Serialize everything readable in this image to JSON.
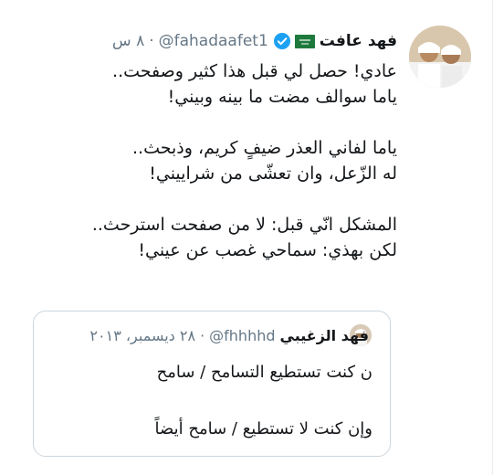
{
  "tweet": {
    "display_name": "فهد عافت",
    "handle": "@fahadaafet1",
    "separator": "·",
    "time": "٨ س",
    "body": "عادي! حصل لي قبل هذا كثير وصفحت..\nياما سوالف مضت ما بينه وبيني!\n\nياما لفاني العذر ضيفٍ كريم، وذبحث..\nله الزّعل، وان تعشّى من شراييني!\n\nالمشكل انّي قبل: لا من صفحت استرحث..\nلكن بهذي: سماحي غصب عن عيني!"
  },
  "quoted": {
    "display_name": "فهد الزغيبي",
    "handle": "@fhhhhd",
    "separator": "·",
    "date": "٢٨ ديسمبر، ٢٠١٣",
    "body": "ن كنت تستطيع التسامح / سامح\n\nوإن كنت لا تستطيع / سامح أيضاً"
  },
  "icons": {
    "verified": "verified-badge-icon",
    "flag": "saudi-flag-icon"
  },
  "colors": {
    "text": "#14171a",
    "muted": "#657786",
    "verified": "#1da1f2",
    "flag": "#1d7a3c",
    "border": "#ccd6dd"
  }
}
